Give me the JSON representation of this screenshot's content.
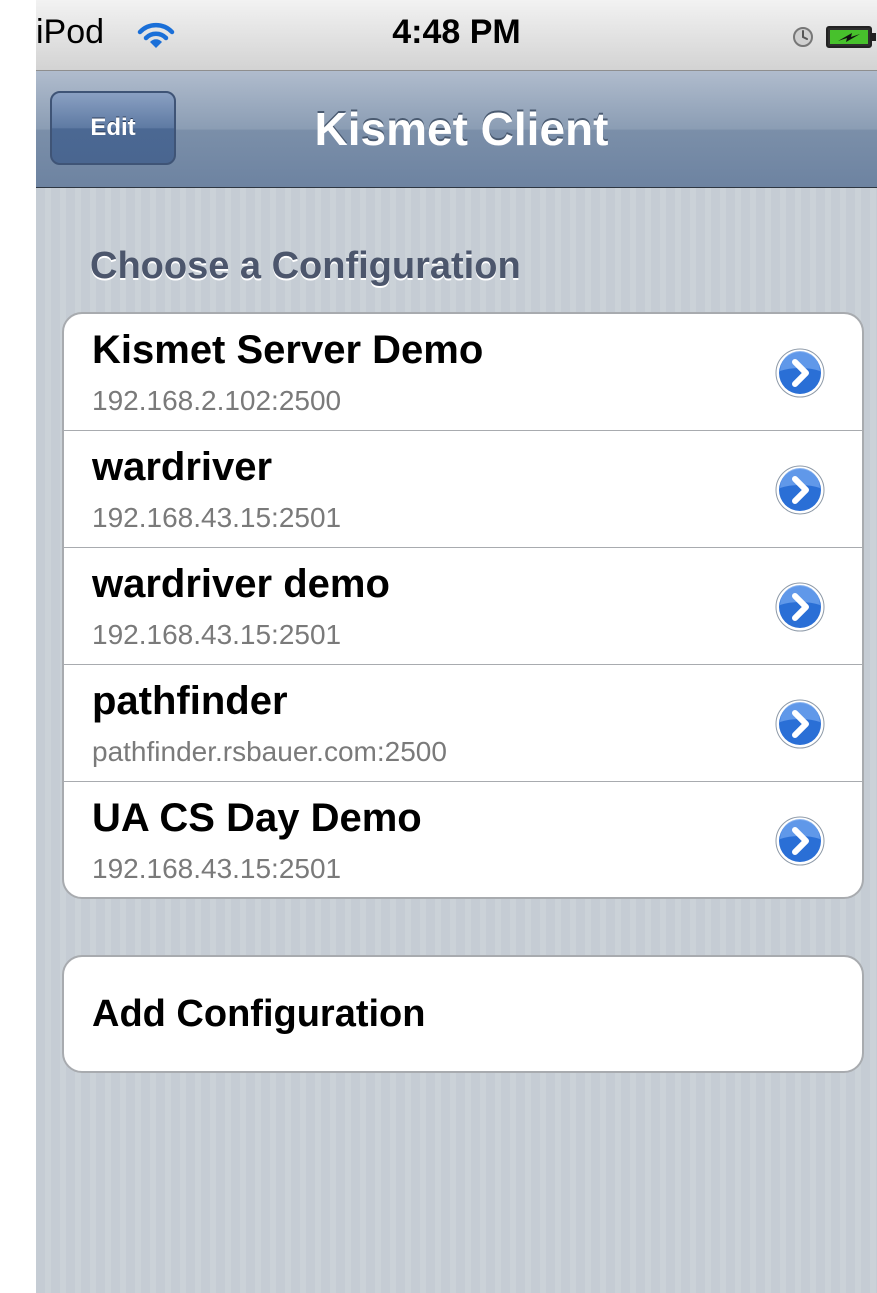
{
  "status_bar": {
    "carrier": "iPod",
    "time": "4:48 PM",
    "icons": [
      "wifi-icon",
      "lock-icon",
      "battery-charging-icon"
    ]
  },
  "nav_bar": {
    "edit_label": "Edit",
    "title": "Kismet Client"
  },
  "section_header": "Choose a Configuration",
  "configurations": [
    {
      "name": "Kismet Server Demo",
      "address": "192.168.2.102:2500"
    },
    {
      "name": "wardriver",
      "address": "192.168.43.15:2501"
    },
    {
      "name": "wardriver demo",
      "address": "192.168.43.15:2501"
    },
    {
      "name": "pathfinder",
      "address": "pathfinder.rsbauer.com:2500"
    },
    {
      "name": "UA CS Day Demo",
      "address": "192.168.43.15:2501"
    }
  ],
  "add_configuration_label": "Add Configuration",
  "colors": {
    "background": "#c5ccd4",
    "nav_bar": "#6d83a1",
    "section_header": "#4c566c",
    "disclosure": "#2a6fd6"
  }
}
